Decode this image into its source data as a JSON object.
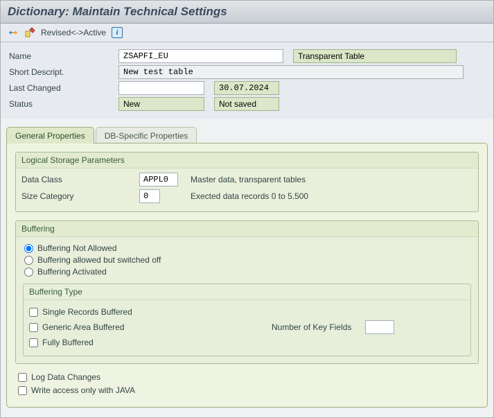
{
  "title": "Dictionary: Maintain Technical Settings",
  "toolbar": {
    "revised_active": "Revised<->Active"
  },
  "header": {
    "name_label": "Name",
    "name_value": "ZSAPFI_EU",
    "table_type": "Transparent Table",
    "shortd_label": "Short Descript.",
    "shortd_value": "New test table",
    "lastchg_label": "Last Changed",
    "lastchg_user": "",
    "lastchg_date": "30.07.2024",
    "status_label": "Status",
    "status1": "New",
    "status2": "Not saved"
  },
  "tabs": {
    "t1": "General Properties",
    "t2": "DB-Specific Properties"
  },
  "storage": {
    "group_title": "Logical Storage Parameters",
    "dataclass_label": "Data Class",
    "dataclass_value": "APPL0",
    "dataclass_desc": "Master data, transparent tables",
    "sizecat_label": "Size Category",
    "sizecat_value": "0",
    "sizecat_desc": "Exected data records 0 to 5.500"
  },
  "buffering": {
    "group_title": "Buffering",
    "r1": "Buffering Not Allowed",
    "r2": "Buffering allowed but switched off",
    "r3": "Buffering Activated",
    "type_title": "Buffering Type",
    "c1": "Single Records Buffered",
    "c2": "Generic Area Buffered",
    "c3": "Fully Buffered",
    "nkey_label": "Number of Key Fields"
  },
  "bottom": {
    "log": "Log Data Changes",
    "java": "Write access only with JAVA"
  }
}
